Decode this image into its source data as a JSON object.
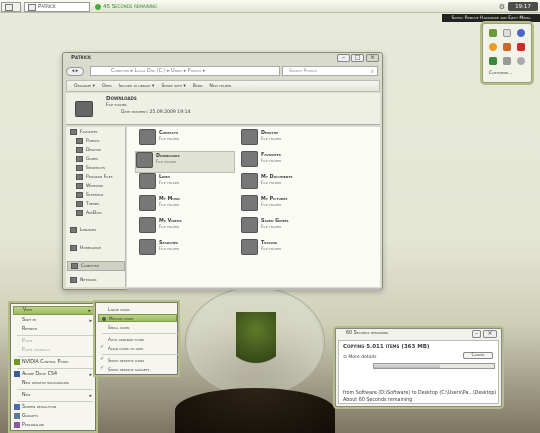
{
  "taskbar": {
    "item1": "",
    "item2": "Patrick",
    "item3": "45 Seconds remaining",
    "clock": "19:17"
  },
  "tooltip": "Safely Remove Hardware and Eject Media",
  "tray": {
    "customize": "Customize..."
  },
  "explorer": {
    "title": "Patrick",
    "path": "Computer ▸ Local Disk (C:) ▸ Users ▸ Patrick ▸",
    "search_placeholder": "Search Patrick",
    "toolbar": [
      "Organize ▾",
      "Open",
      "Include in library ▾",
      "Share with ▾",
      "Burn",
      "New folder"
    ],
    "details": {
      "name": "Downloads",
      "type": "File folder",
      "date": "Date modified: 25.09.2009 19:14"
    },
    "nav": [
      "Favorites",
      "Patrick",
      "Desktop",
      "Games",
      "Shortcuts",
      "Program Files",
      "Windows",
      "Systemcz",
      "Themes",
      "AppData",
      "Libraries",
      "Homegroup",
      "Computer",
      "Network"
    ],
    "items": [
      {
        "name": "Contacts",
        "type": "File folder"
      },
      {
        "name": "Desktop",
        "type": "File folder"
      },
      {
        "name": "Downloads",
        "type": "File folder"
      },
      {
        "name": "Favorites",
        "type": "File folder"
      },
      {
        "name": "Links",
        "type": "File folder"
      },
      {
        "name": "My Documents",
        "type": "File folder"
      },
      {
        "name": "My Music",
        "type": "File folder"
      },
      {
        "name": "My Pictures",
        "type": "File folder"
      },
      {
        "name": "My Videos",
        "type": "File folder"
      },
      {
        "name": "Saved Games",
        "type": "File folder"
      },
      {
        "name": "Searches",
        "type": "File folder"
      },
      {
        "name": "Tracing",
        "type": "File folder"
      }
    ]
  },
  "context_menu": [
    "View",
    "Sort by",
    "Refresh",
    "Paste",
    "Paste shortcut",
    "NVIDIA Control Panel",
    "Adobe Drive CS4",
    "New desktop background",
    "New",
    "Screen resolution",
    "Gadgets",
    "Personalize"
  ],
  "view_submenu": [
    "Large icons",
    "Medium icons",
    "Small icons",
    "Auto arrange icons",
    "Align icons to grid",
    "Show desktop icons",
    "Show desktop gadgets"
  ],
  "copy_dialog": {
    "title": "60 Seconds remaining",
    "heading": "Copying 5.011 items (363 MB)",
    "cancel": "Cancel",
    "more_details": "More details",
    "progress": 0.55,
    "from": "from Software (D:\\Software) to Desktop (C:\\Users\\Pa...\\Desktop)",
    "about": "About 60 Seconds remaining"
  }
}
